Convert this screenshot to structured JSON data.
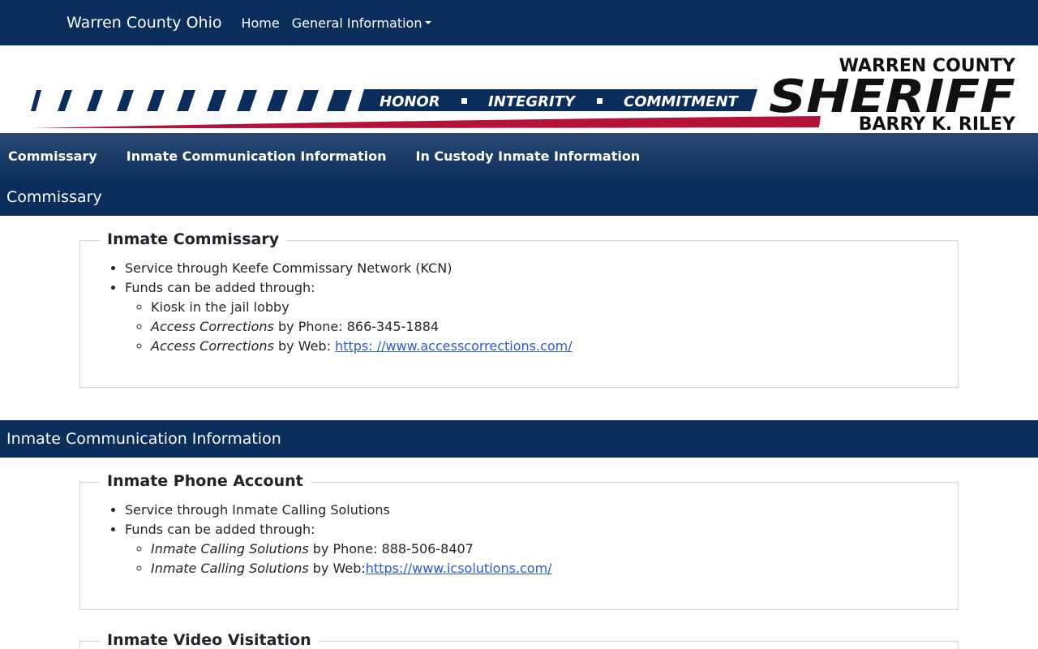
{
  "topnav": {
    "brand": "Warren County Ohio",
    "home": "Home",
    "general": "General Information"
  },
  "banner": {
    "motto1": "HONOR",
    "motto2": "INTEGRITY",
    "motto3": "COMMITMENT",
    "logo_line1": "WARREN COUNTY",
    "logo_line2": "SHERIFF",
    "logo_line3": "BARRY K. RILEY",
    "colors": {
      "navy": "#0a2d5c",
      "red": "#b5123a"
    }
  },
  "subnav": {
    "items": [
      "Commissary",
      "Inmate Communication Information",
      "In Custody Inmate Information"
    ]
  },
  "sections": {
    "commissary": {
      "header": "Commissary",
      "legend": "Inmate Commissary",
      "item1": "Service through Keefe Commissary Network (KCN)",
      "item2": "Funds can be added through:",
      "sub1": "Kiosk in the jail lobby",
      "sub2_em": "Access Corrections",
      "sub2_text": " by Phone: 866-345-1884",
      "sub3_em": "Access Corrections",
      "sub3_text": " by Web: ",
      "sub3_link": "https: //www.accesscorrections.com/"
    },
    "communication": {
      "header": "Inmate Communication Information",
      "legend": "Inmate Phone Account",
      "item1": "Service through Inmate Calling Solutions",
      "item2": "Funds can be added through:",
      "sub1_em": "Inmate Calling Solutions",
      "sub1_text": " by Phone: 888-506-8407",
      "sub2_em": "Inmate Calling Solutions",
      "sub2_text": " by Web:",
      "sub2_link": "https://www.icsolutions.com/",
      "legend2": "Inmate Video Visitation"
    }
  }
}
